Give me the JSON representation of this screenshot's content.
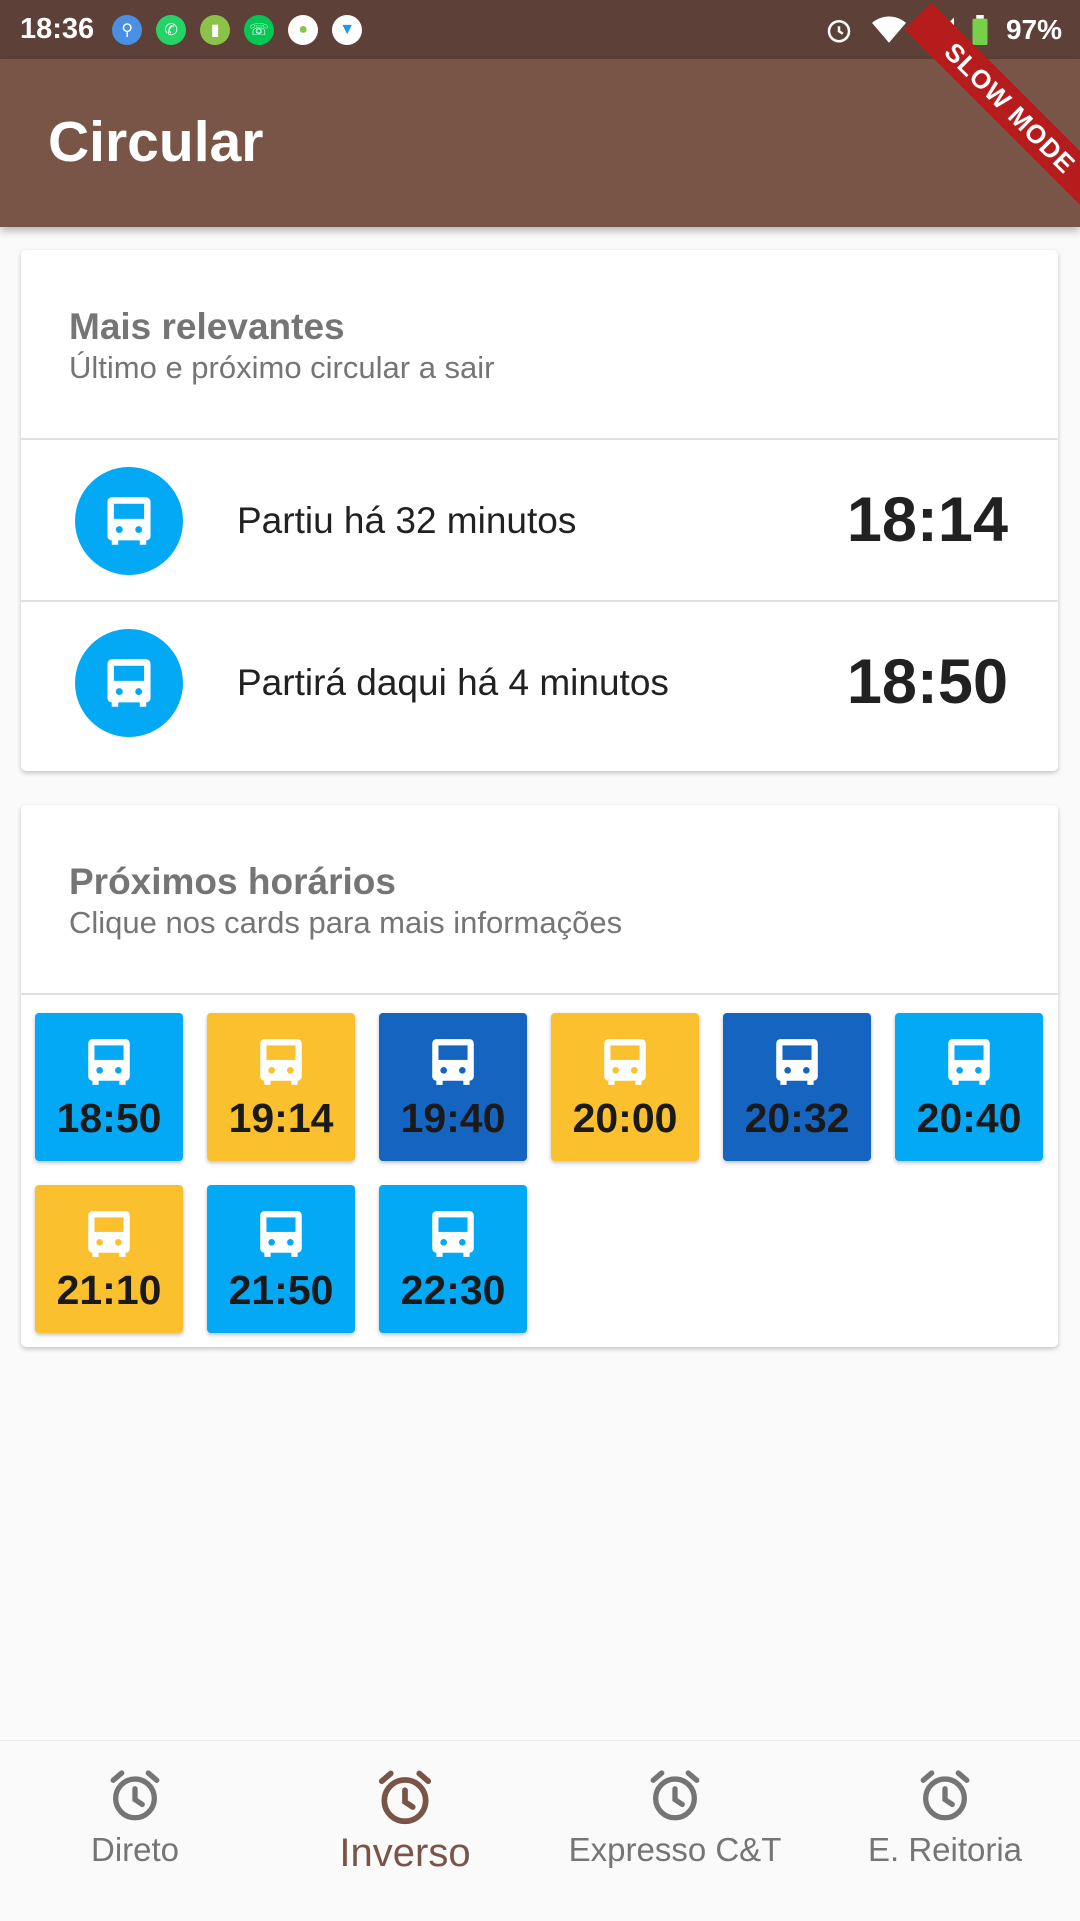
{
  "status_bar": {
    "time": "18:36",
    "battery": "97%",
    "ribbon": "SLOW MODE",
    "icons": [
      "usb-icon",
      "whatsapp-icon",
      "battery-charging-app-icon",
      "phone-app-icon",
      "android-icon",
      "microphone-icon"
    ]
  },
  "app_bar": {
    "title": "Circular"
  },
  "relevant": {
    "title": "Mais relevantes",
    "subtitle": "Último e próximo circular a sair",
    "items": [
      {
        "text": "Partiu há 32 minutos",
        "time": "18:14"
      },
      {
        "text": "Partirá daqui há 4 minutos",
        "time": "18:50"
      }
    ]
  },
  "schedule": {
    "title": "Próximos horários",
    "subtitle": "Clique nos cards para mais informações",
    "tiles": [
      {
        "time": "18:50",
        "color": "#03a9f4"
      },
      {
        "time": "19:14",
        "color": "#fbc02d"
      },
      {
        "time": "19:40",
        "color": "#1565c0"
      },
      {
        "time": "20:00",
        "color": "#fbc02d"
      },
      {
        "time": "20:32",
        "color": "#1565c0"
      },
      {
        "time": "20:40",
        "color": "#03a9f4"
      },
      {
        "time": "21:10",
        "color": "#fbc02d"
      },
      {
        "time": "21:50",
        "color": "#03a9f4"
      },
      {
        "time": "22:30",
        "color": "#03a9f4"
      }
    ]
  },
  "bottom_nav": {
    "items": [
      {
        "label": "Direto",
        "active": false
      },
      {
        "label": "Inverso",
        "active": true
      },
      {
        "label": "Expresso C&T",
        "active": false
      },
      {
        "label": "E. Reitoria",
        "active": false
      }
    ]
  },
  "colors": {
    "app_bar": "#795548",
    "status_bar": "#5d4037",
    "bus_blue": "#03a9f4",
    "bus_dark_blue": "#1565c0",
    "bus_yellow": "#fbc02d",
    "nav_active": "#795548",
    "nav_inactive": "#757575"
  }
}
